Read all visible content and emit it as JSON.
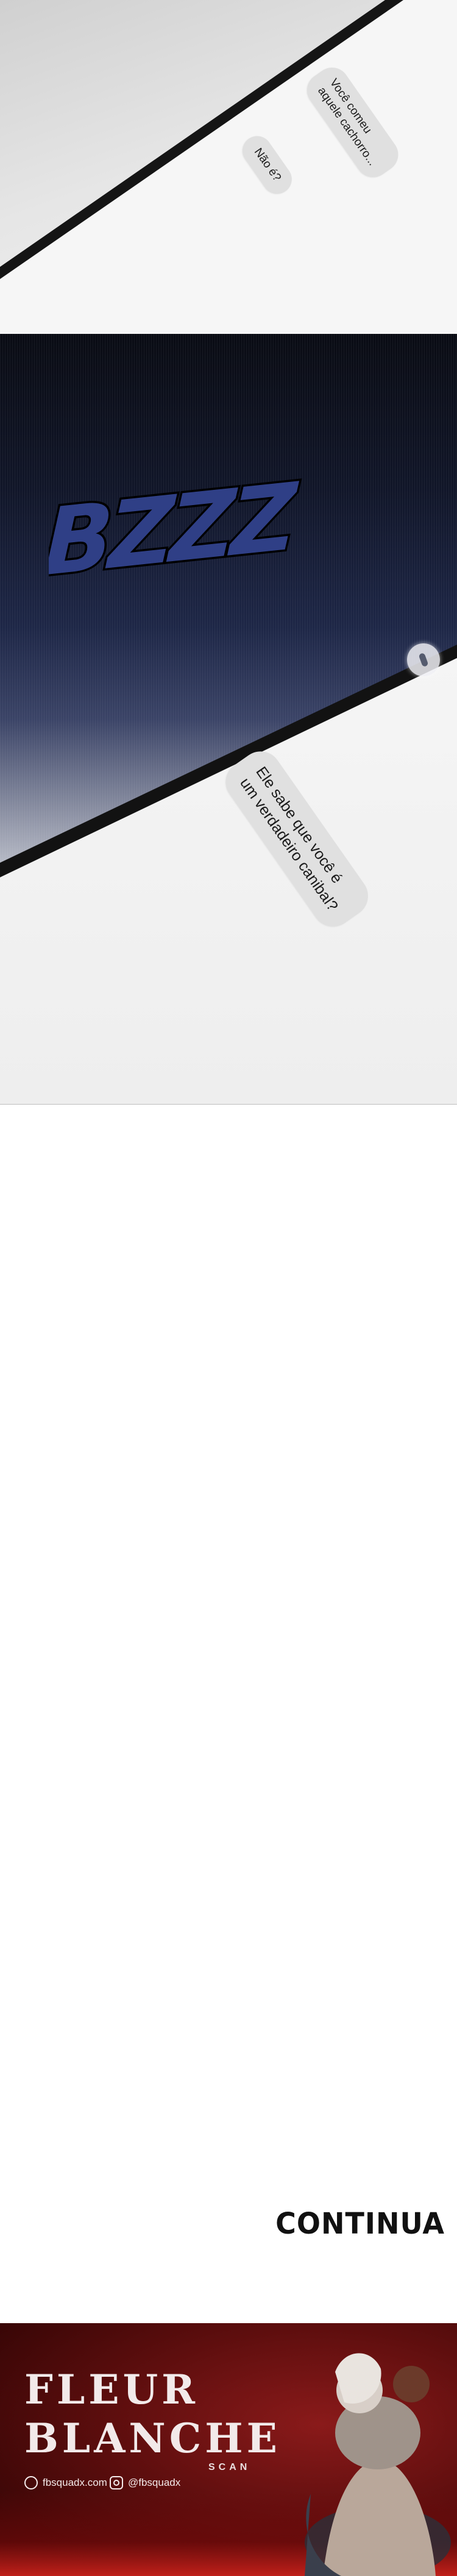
{
  "panel_1": {
    "bubble_top": [
      "Você comeu",
      "aquele cachorro..."
    ],
    "bubble_bottom": "Não é?"
  },
  "panel_2": {
    "sfx": "BZZZ",
    "bubble": [
      "Ele sabe que você é",
      "um verdadeiro canibal?"
    ]
  },
  "end_label": "CONTINUA",
  "banner": {
    "logo_line_1": "FLEUR",
    "logo_line_2": "BLANCHE",
    "logo_line_3": "SCAN",
    "facebook": "fbsquadx.com",
    "instagram": "@fbsquadx",
    "colors": {
      "background": "#5e0e0e",
      "accent": "#c0201a"
    }
  }
}
